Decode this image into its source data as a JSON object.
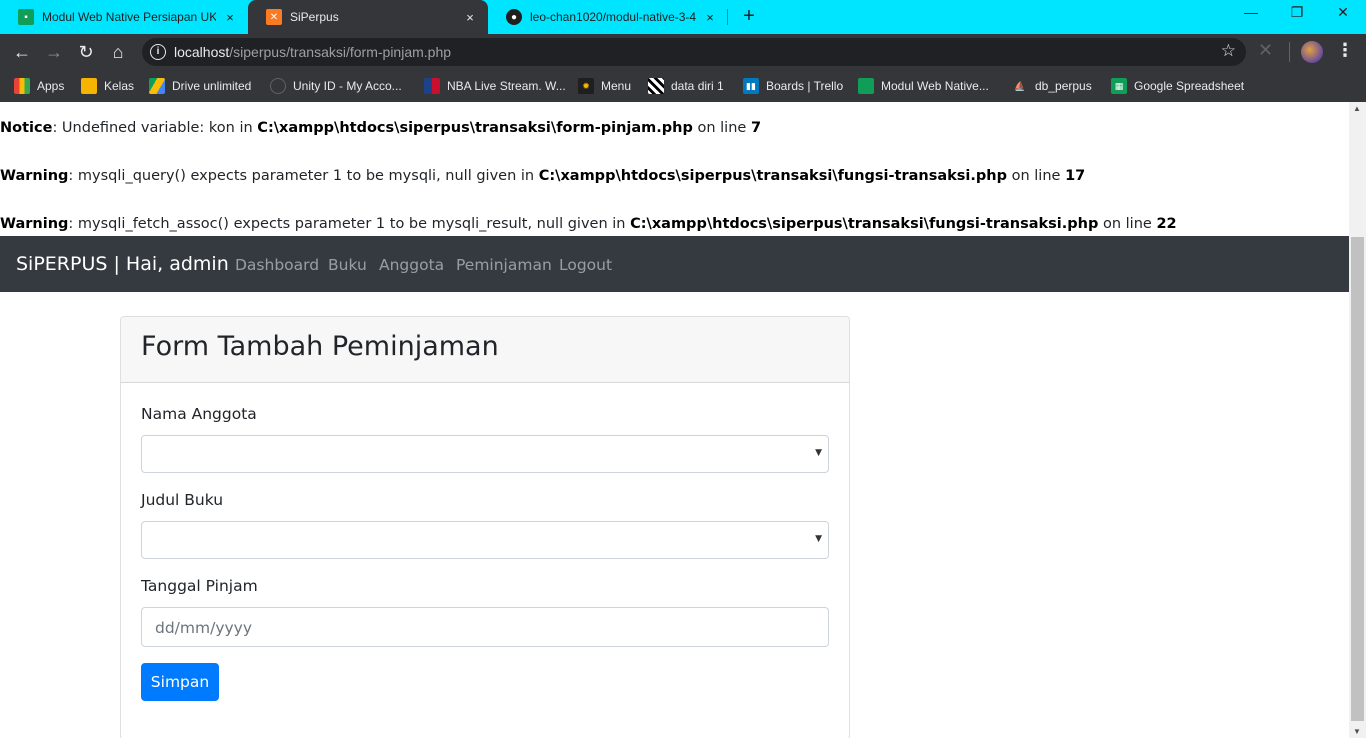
{
  "browser": {
    "tabs": [
      {
        "title": "Modul Web Native Persiapan UKK",
        "close": "×"
      },
      {
        "title": "SiPerpus",
        "close": "×"
      },
      {
        "title": "leo-chan1020/modul-native-3-4",
        "close": "×"
      }
    ],
    "new_tab": "+",
    "window_controls": {
      "minimize": "—",
      "restore": "❐",
      "close": "✕"
    },
    "url_host": "localhost",
    "url_path": "/siperpus/transaksi/form-pinjam.php",
    "bookmarks": [
      "Apps",
      "Kelas",
      "Drive unlimited",
      "Unity ID - My Acco...",
      "NBA Live Stream. W...",
      "Menu",
      "data diri 1",
      "Boards | Trello",
      "Modul Web Native...",
      "db_perpus",
      "Google Spreadsheet"
    ]
  },
  "php_messages": [
    {
      "level": "Notice",
      "text": ": Undefined variable: kon in ",
      "file": "C:\\xampp\\htdocs\\siperpus\\transaksi\\form-pinjam.php",
      "on_line": " on line ",
      "line": "7"
    },
    {
      "level": "Warning",
      "text": ": mysqli_query() expects parameter 1 to be mysqli, null given in ",
      "file": "C:\\xampp\\htdocs\\siperpus\\transaksi\\fungsi-transaksi.php",
      "on_line": " on line ",
      "line": "17"
    },
    {
      "level": "Warning",
      "text": ": mysqli_fetch_assoc() expects parameter 1 to be mysqli_result, null given in ",
      "file": "C:\\xampp\\htdocs\\siperpus\\transaksi\\fungsi-transaksi.php",
      "on_line": " on line ",
      "line": "22"
    }
  ],
  "navbar": {
    "brand": "SiPERPUS | Hai, admin",
    "links": [
      "Dashboard",
      "Buku",
      "Anggota",
      "Peminjaman",
      "Logout"
    ]
  },
  "form": {
    "title": "Form Tambah Peminjaman",
    "fields": {
      "member": {
        "label": "Nama Anggota",
        "value": ""
      },
      "book": {
        "label": "Judul Buku",
        "value": ""
      },
      "date": {
        "label": "Tanggal Pinjam",
        "placeholder": "dd/mm/yyyy"
      }
    },
    "submit_label": "Simpan"
  }
}
